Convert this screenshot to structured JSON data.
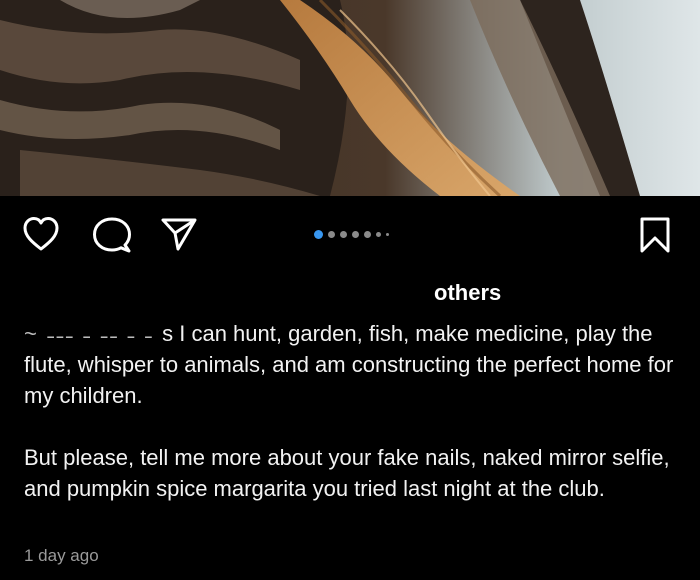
{
  "post": {
    "image": {
      "description_icon": "tiger-fur-photo-icon"
    },
    "actions": {
      "like_icon": "heart-icon",
      "comment_icon": "comment-bubble-icon",
      "share_icon": "paper-plane-icon",
      "save_icon": "bookmark-icon"
    },
    "carousel": {
      "count": 7,
      "active_index": 0
    },
    "liked_by": {
      "suffix": "others"
    },
    "caption": {
      "line1": "s I can hunt, garden, fish, make medicine, play the flute, whisper to animals, and am constructing the perfect home for my children.",
      "line2": "But please, tell me more about your fake nails, naked mirror selfie, and pumpkin spice margarita you tried last night at the club."
    },
    "timestamp": "1 day ago"
  },
  "colors": {
    "background": "#000000",
    "text": "#ffffff",
    "muted": "#9a9a9a",
    "carousel_active": "#3897f0"
  }
}
